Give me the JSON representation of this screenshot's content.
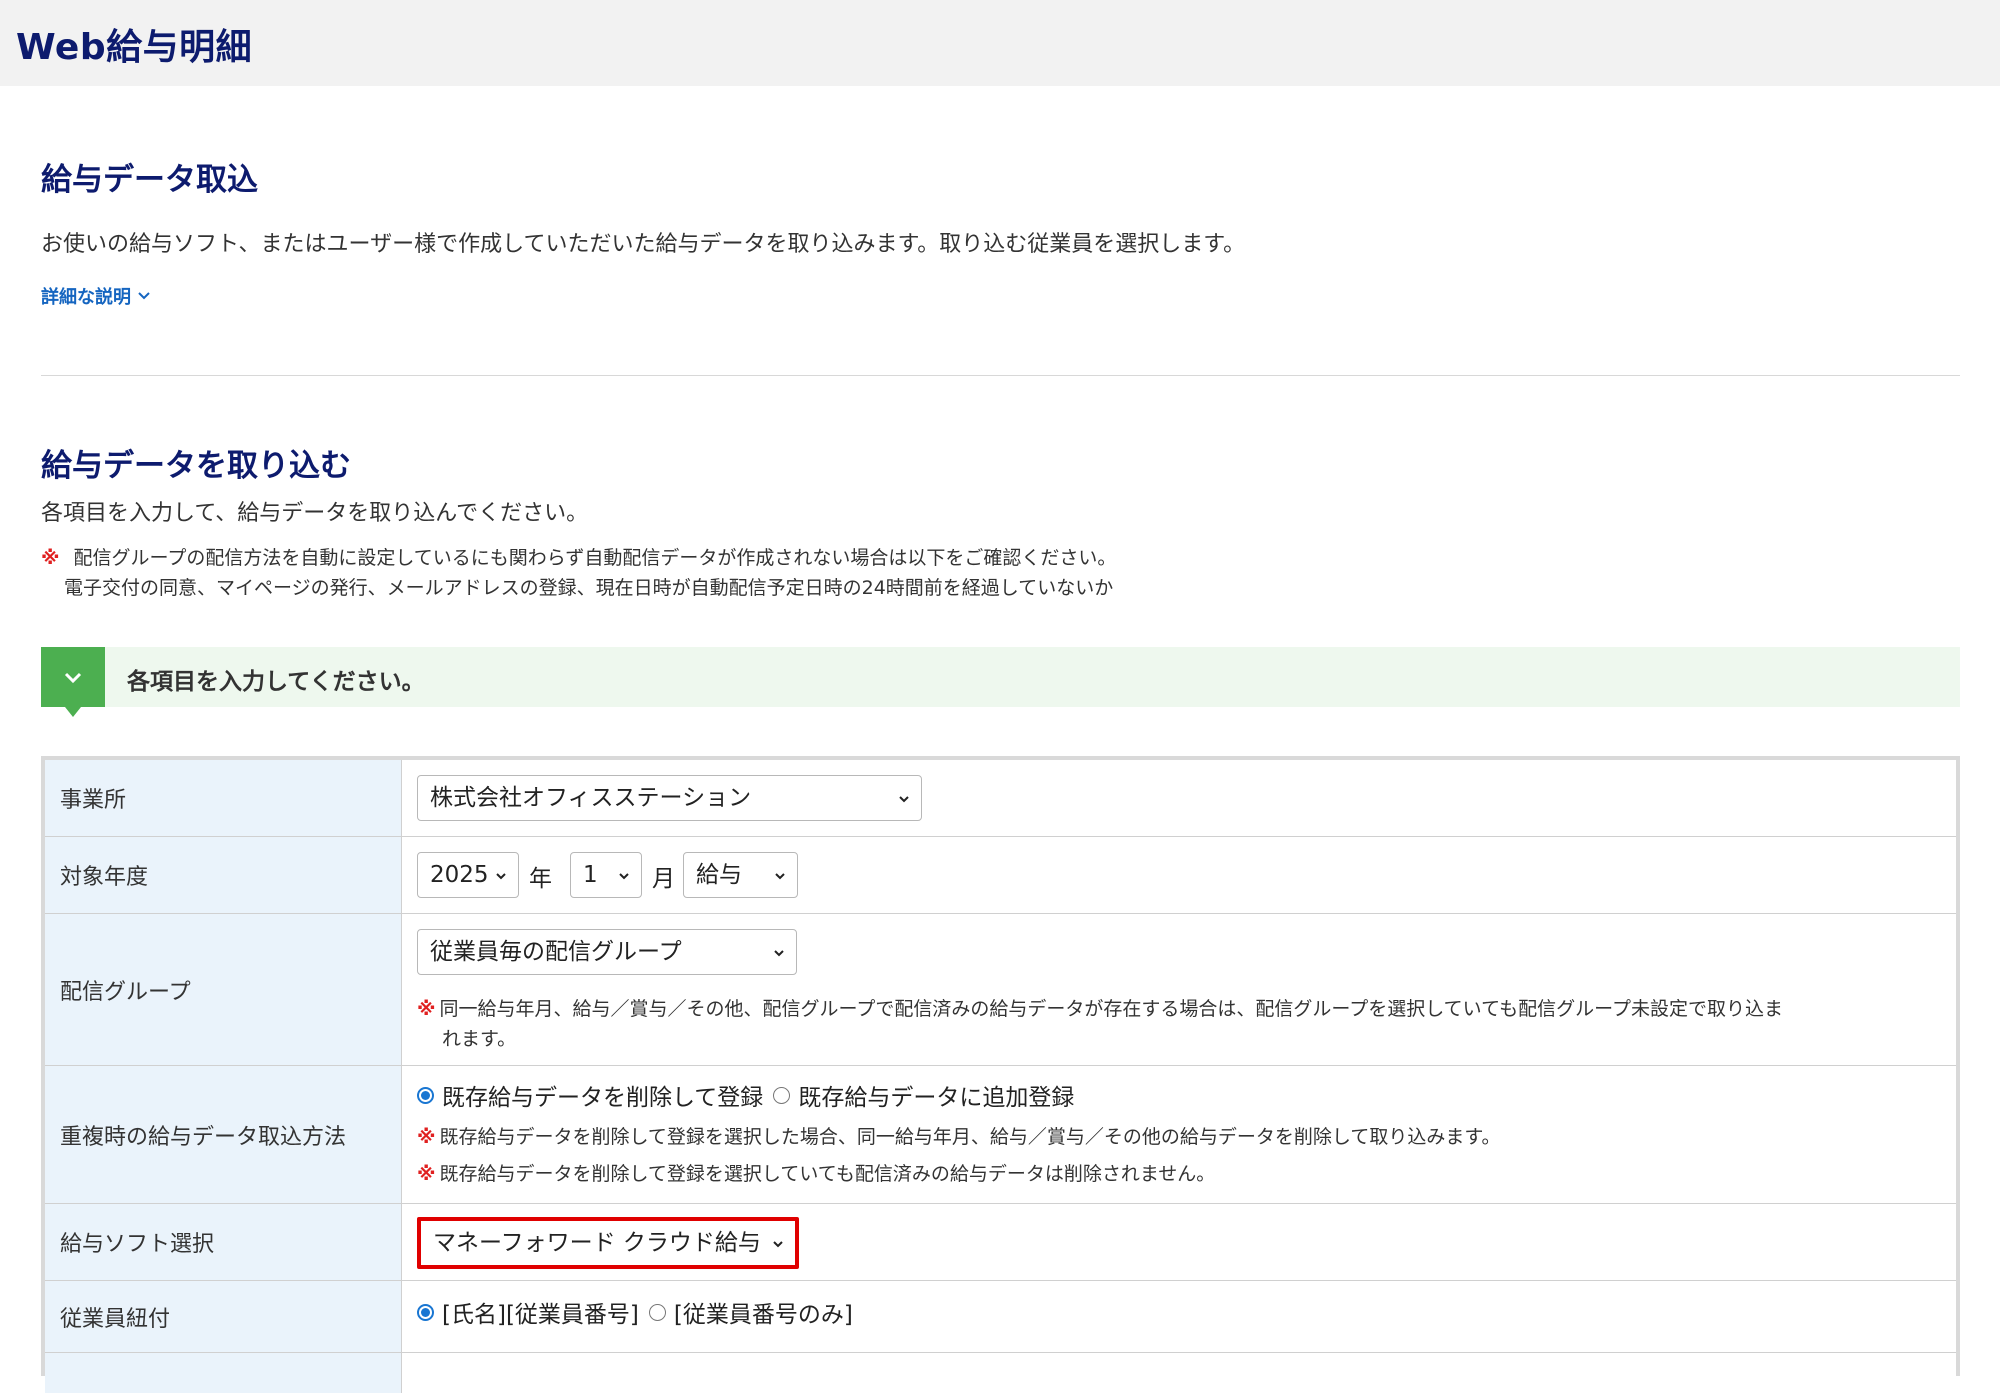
{
  "app": {
    "title": "Web給与明細"
  },
  "import_section": {
    "title": "給与データ取込",
    "description": "お使いの給与ソフト、またはユーザー様で作成していただいた給与データを取り込みます。取り込む従業員を選択します。",
    "detail_link": "詳細な説明"
  },
  "load_section": {
    "title": "給与データを取り込む",
    "description": "各項目を入力して、給与データを取り込んでください。",
    "note_mark": "※",
    "note_line1": "配信グループの配信方法を自動に設定しているにも関わらず自動配信データが作成されない場合は以下をご確認ください。",
    "note_line2": "電子交付の同意、マイページの発行、メールアドレスの登録、現在日時が自動配信予定日時の24時間前を経過していないか"
  },
  "banner": {
    "text": "各項目を入力してください。"
  },
  "form": {
    "office": {
      "label": "事業所",
      "value": "株式会社オフィスステーション"
    },
    "period": {
      "label": "対象年度",
      "year": "2025",
      "year_unit": "年",
      "month": "1",
      "month_unit": "月",
      "type": "給与"
    },
    "group": {
      "label": "配信グループ",
      "value": "従業員毎の配信グループ",
      "note_mark": "※",
      "note_line1": "同一給与年月、給与／賞与／その他、配信グループで配信済みの給与データが存在する場合は、配信グループを選択していても配信グループ未設定で取り込ま",
      "note_line2": "れます。"
    },
    "duplicate": {
      "label": "重複時の給与データ取込方法",
      "option1": "既存給与データを削除して登録",
      "option2": "既存給与データに追加登録",
      "note_mark": "※",
      "note1": "既存給与データを削除して登録を選択した場合、同一給与年月、給与／賞与／その他の給与データを削除して取り込みます。",
      "note2": "既存給与データを削除して登録を選択していても配信済みの給与データは削除されません。"
    },
    "software": {
      "label": "給与ソフト選択",
      "value": "マネーフォワード クラウド給与"
    },
    "employee_link": {
      "label": "従業員紐付",
      "option1": "[氏名][従業員番号]",
      "option2": "[従業員番号のみ]"
    }
  },
  "colors": {
    "title": "#0d1b6e",
    "link": "#1565c0",
    "banner_accent": "#4caf50",
    "label_bg": "#eaf3fb",
    "note_mark": "#e02020",
    "highlight": "#e00000"
  }
}
